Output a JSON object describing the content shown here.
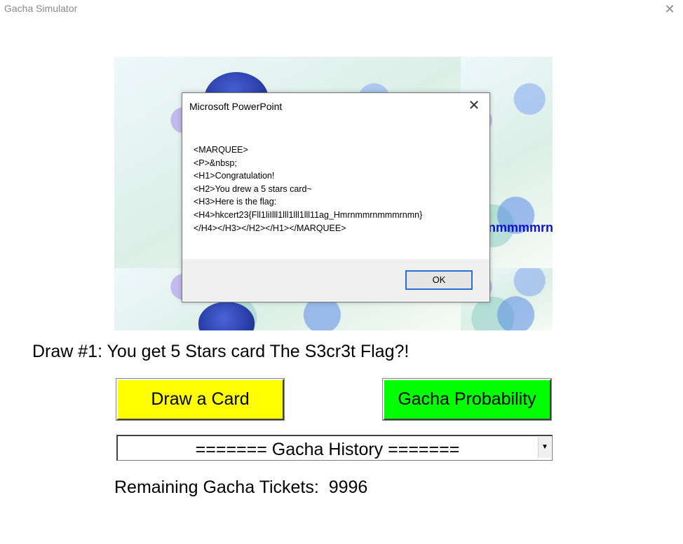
{
  "window": {
    "title": "Gacha Simulator",
    "close_glyph": "✕"
  },
  "card": {
    "marquee_fragment": "rnmmmmrn"
  },
  "dialog": {
    "title": "Microsoft PowerPoint",
    "close_glyph": "✕",
    "message": "<MARQUEE>\n<P>&nbsp;\n<H1>Congratulation!\n<H2>You drew a 5 stars card~\n<H3>Here is the flag:\n<H4>hkcert23{Fll1liIlll1lll1lll1lll11ag_Hmrnmmrnmmmrnmn}\n</H4></H3></H2></H1></MARQUEE>",
    "ok_label": "OK"
  },
  "main": {
    "draw_result": "Draw #1: You get 5 Stars card The S3cr3t Flag?!",
    "draw_button_label": "Draw a Card",
    "probability_button_label": "Gacha Probability",
    "history_selected": "======= Gacha History =======",
    "history_arrow": "▼",
    "tickets_label": "Remaining Gacha Tickets:  9996"
  },
  "colors": {
    "draw_button": "#ffff00",
    "probability_button": "#00ff00",
    "marquee_text": "#1010c8",
    "ok_focus_border": "#2a6fd6"
  },
  "icons": {
    "window_close": "close-icon",
    "dialog_close": "close-icon",
    "dropdown": "chevron-down-icon"
  }
}
